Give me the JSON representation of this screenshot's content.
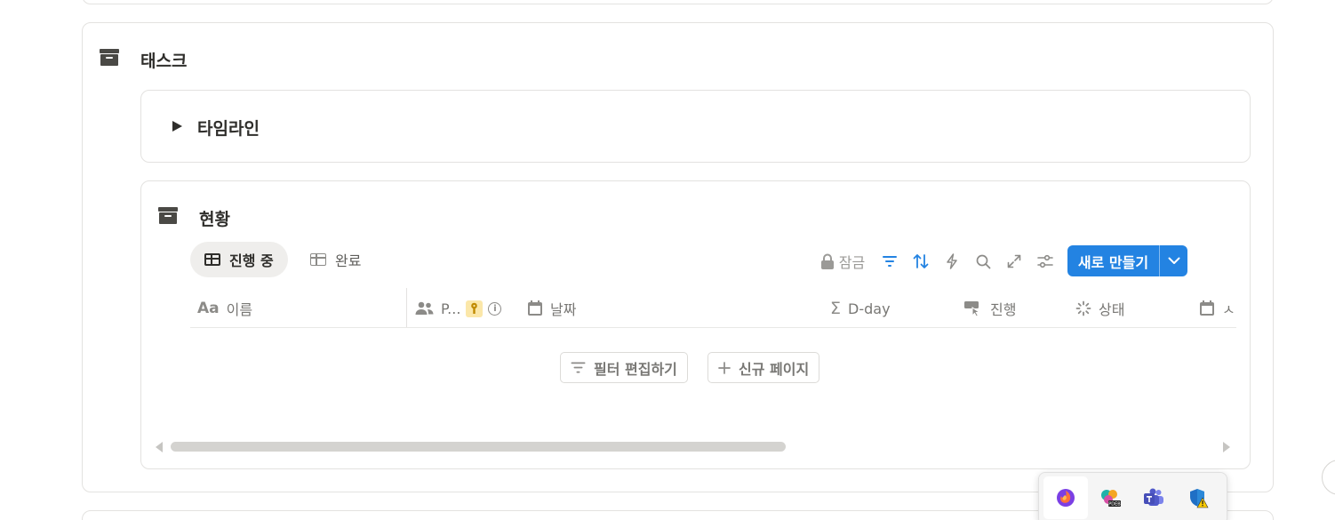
{
  "page": {
    "section_title": "태스크"
  },
  "timeline": {
    "title": "타임라인"
  },
  "status": {
    "title": "현황",
    "tabs": [
      {
        "label": "진행 중",
        "active": true
      },
      {
        "label": "완료",
        "active": false
      }
    ],
    "toolbar": {
      "lock_label": "잠금",
      "icons": [
        "filter-icon",
        "sort-icon",
        "automation-icon",
        "search-icon",
        "expand-icon",
        "settings-icon"
      ],
      "new_button_label": "새로 만들기",
      "accent": "#2383e2"
    },
    "columns": [
      {
        "icon": "text-icon",
        "label": "이름",
        "glyph": "Aa"
      },
      {
        "icon": "people-icon",
        "label": "P..."
      },
      {
        "icon": "calendar-icon",
        "label": "날짜"
      },
      {
        "icon": "formula-icon",
        "label": "D-day",
        "glyph": "Σ"
      },
      {
        "icon": "rollup-icon",
        "label": "진행"
      },
      {
        "icon": "status-icon",
        "label": "상태"
      },
      {
        "icon": "calendar-icon",
        "label": "ㅅ"
      }
    ],
    "empty_actions": {
      "edit_filter": "필터 편집하기",
      "new_page": "신규 페이지"
    }
  },
  "tray": {
    "apps": [
      "firefox-icon",
      "screenshot-tool-icon",
      "teams-icon",
      "security-warning-icon"
    ],
    "badge_text": "PDEB"
  }
}
